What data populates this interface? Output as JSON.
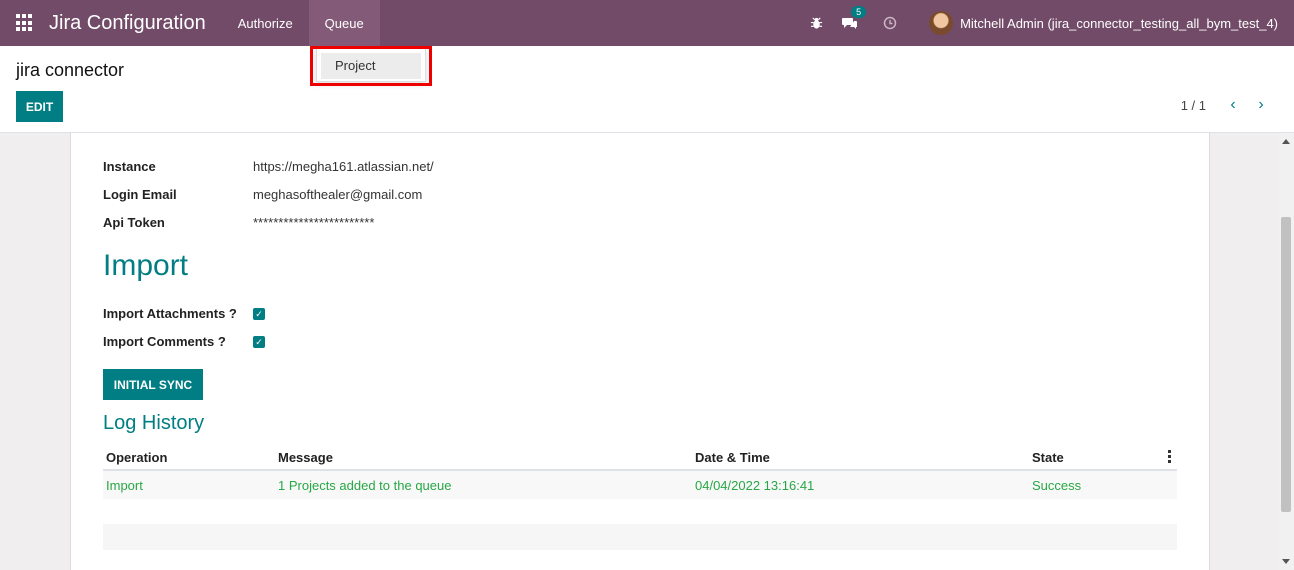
{
  "navbar": {
    "app_title": "Jira Configuration",
    "menu": [
      {
        "label": "Authorize"
      },
      {
        "label": "Queue"
      }
    ],
    "messages_count": "5",
    "user_name": "Mitchell Admin (jira_connector_testing_all_bym_test_4)"
  },
  "dropdown": {
    "items": [
      {
        "label": "Project"
      }
    ]
  },
  "control_panel": {
    "title": "jira connector",
    "edit_label": "EDIT",
    "pager": "1 / 1"
  },
  "form": {
    "fields": [
      {
        "label": "Instance",
        "value": "https://megha161.atlassian.net/"
      },
      {
        "label": "Login Email",
        "value": "meghasofthealer@gmail.com"
      },
      {
        "label": "Api Token",
        "value": "************************"
      }
    ],
    "import_title": "Import",
    "import_options": [
      {
        "label": "Import Attachments ?",
        "checked": true
      },
      {
        "label": "Import Comments ?",
        "checked": true
      }
    ],
    "sync_label": "INITIAL SYNC",
    "log_title": "Log History",
    "log_columns": [
      "Operation",
      "Message",
      "Date & Time",
      "State"
    ],
    "log_rows": [
      {
        "operation": "Import",
        "message": "1 Projects added to the queue",
        "datetime": "04/04/2022 13:16:41",
        "state": "Success"
      }
    ]
  },
  "colors": {
    "navbar": "#714b67",
    "accent": "#017e84",
    "success": "#28a745"
  }
}
